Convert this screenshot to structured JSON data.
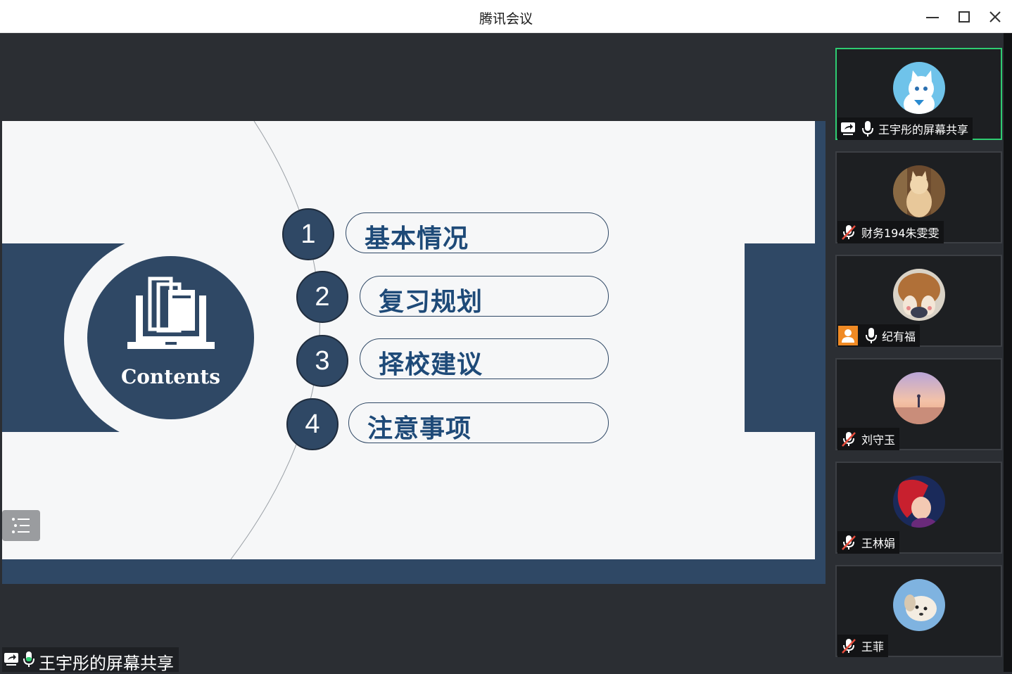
{
  "window": {
    "title": "腾讯会议"
  },
  "slide": {
    "contents_label": "Contents",
    "items": [
      {
        "num": "1",
        "label": "基本情况"
      },
      {
        "num": "2",
        "label": "复习规划"
      },
      {
        "num": "3",
        "label": "择校建议"
      },
      {
        "num": "4",
        "label": "注意事项"
      }
    ]
  },
  "share_label": "王宇彤的屏幕共享",
  "participants": [
    {
      "name": "王宇彤的屏幕共享",
      "mic": "on",
      "sharing": true,
      "avatar": "white-cat-avatar"
    },
    {
      "name": "财务194朱雯雯",
      "mic": "muted",
      "avatar": "cat-light-avatar"
    },
    {
      "name": "纪有福",
      "mic": "on",
      "avatar": "corgi-avatar",
      "person_icon": true
    },
    {
      "name": "刘守玉",
      "mic": "muted",
      "avatar": "sunset-avatar"
    },
    {
      "name": "王林娟",
      "mic": "muted",
      "avatar": "mermaid-avatar"
    },
    {
      "name": "王菲",
      "mic": "muted",
      "avatar": "puppy-avatar"
    }
  ],
  "colors": {
    "accent": "#2f4865",
    "pill_text": "#1e4a78",
    "active_border": "#2ecc71",
    "mic_on": "#ffffff",
    "muted": "#ffffff"
  }
}
